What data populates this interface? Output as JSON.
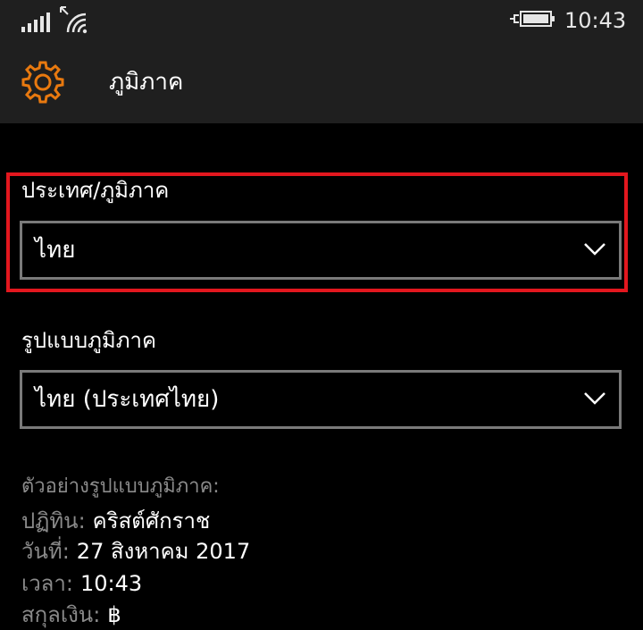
{
  "status_bar": {
    "signal_icon": "signal-bars-icon",
    "wifi_icon": "wifi-icon",
    "battery_icon": "battery-charging-icon",
    "time": "10:43"
  },
  "header": {
    "icon": "gear-icon",
    "icon_color": "#e8790f",
    "title": "ภูมิภาค"
  },
  "country_region": {
    "label": "ประเทศ/ภูมิภาค",
    "value": "ไทย",
    "highlight_color": "#e3171e"
  },
  "regional_format": {
    "label": "รูปแบบภูมิภาค",
    "value": "ไทย (ประเทศไทย)"
  },
  "preview": {
    "heading": "ตัวอย่างรูปแบบภูมิภาค:",
    "rows": [
      {
        "key": "ปฏิทิน:",
        "value": "คริสต์ศักราช"
      },
      {
        "key": "วันที่:",
        "value": "27  สิงหาคม 2017"
      },
      {
        "key": "เวลา:",
        "value": "10:43"
      },
      {
        "key": "สกุลเงิน:",
        "value": "฿"
      }
    ]
  }
}
